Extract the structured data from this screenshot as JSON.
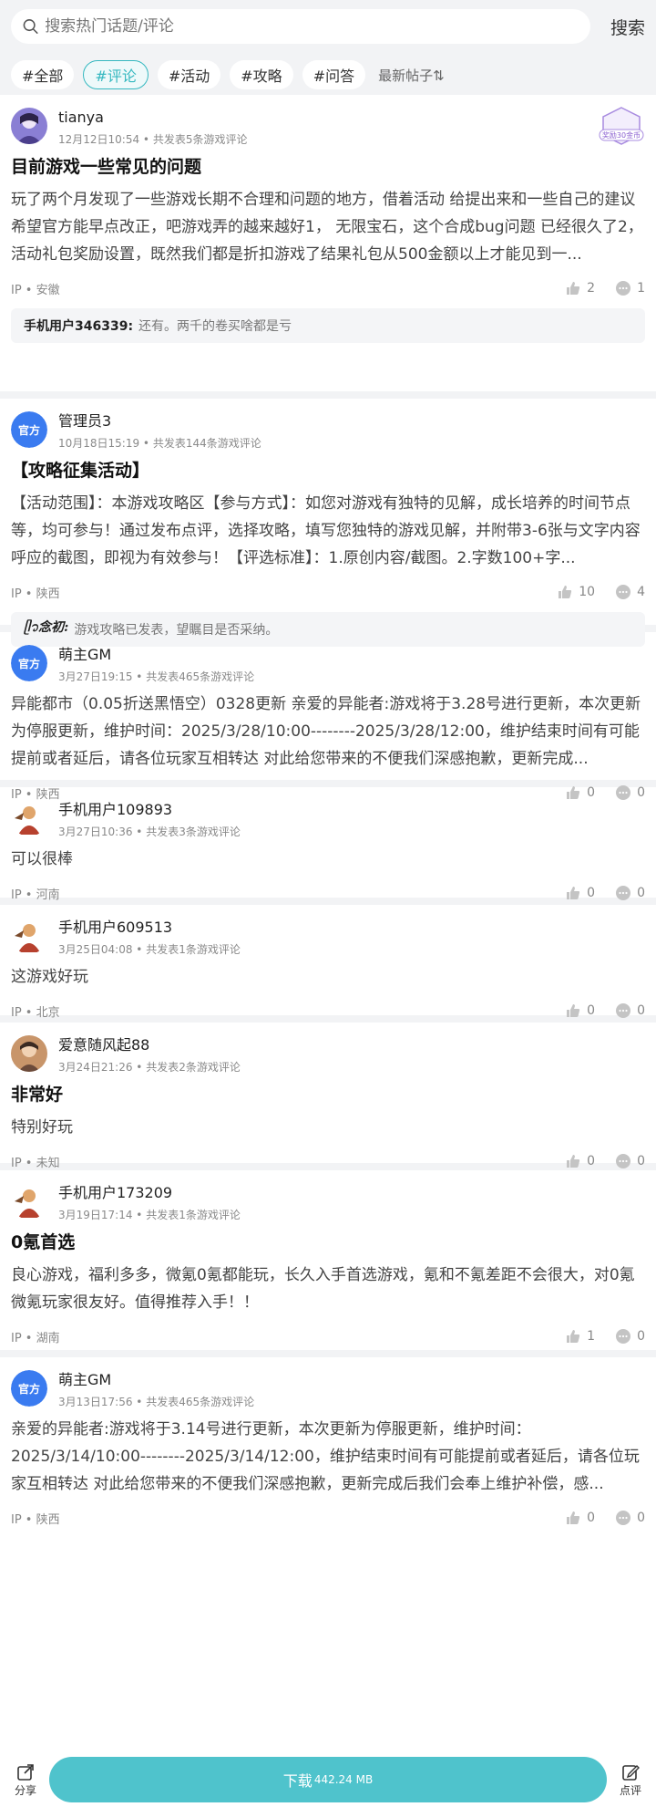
{
  "search": {
    "placeholder": "搜索热门话题/评论",
    "button": "搜索"
  },
  "filters": {
    "tags": [
      "#全部",
      "#评论",
      "#活动",
      "#攻略",
      "#问答"
    ],
    "active": "#评论",
    "sort": "最新帖子⇅"
  },
  "posts": [
    {
      "user": "tianya",
      "sub": "12月12日10:54 • 共发表5条游戏评论",
      "title": "目前游戏一些常见的问题",
      "content": "玩了两个月发现了一些游戏长期不合理和问题的地方，借着活动 给提出来和一些自己的建议 希望官方能早点改正，吧游戏弄的越来越好1， 无限宝石，这个合成bug问题 已经很久了2，活动礼包奖励设置，既然我们都是折扣游戏了结果礼包从500金额以上才能见到一...",
      "ip": "IP • 安徽",
      "likes": "2",
      "comments": "1",
      "badge": "奖励30金币",
      "reply_user": "手机用户346339:",
      "reply_text": "还有。两千的卷买啥都是亏"
    },
    {
      "user": "管理员3",
      "sub": "10月18日15:19 • 共发表144条游戏评论",
      "title": "【攻略征集活动】",
      "content": "【活动范围】：本游戏攻略区【参与方式】：如您对游戏有独特的见解，成长培养的时间节点等，均可参与！通过发布点评，选择攻略，填写您独特的游戏见解，并附带3-6张与文字内容呼应的截图，即视为有效参与！【评选标准】：1.原创内容/截图。2.字数100+字...",
      "ip": "IP • 陕西",
      "likes": "10",
      "comments": "4",
      "reply_user": "ᥫ᭡念初:",
      "reply_text": "游戏攻略已发表，望瞩目是否采纳。"
    },
    {
      "user": "萌主GM",
      "sub": "3月27日19:15 • 共发表465条游戏评论",
      "content": "异能都市（0.05折送黑悟空）0328更新 亲爱的异能者:游戏将于3.28号进行更新，本次更新为停服更新，维护时间：2025/3/28/10:00--------2025/3/28/12:00，维护结束时间有可能提前或者延后，请各位玩家互相转达 对此给您带来的不便我们深感抱歉，更新完成...",
      "ip": "IP • 陕西",
      "likes": "0",
      "comments": "0"
    },
    {
      "user": "手机用户109893",
      "sub": "3月27日10:36 • 共发表3条游戏评论",
      "content": "可以很棒",
      "ip": "IP • 河南",
      "likes": "0",
      "comments": "0"
    },
    {
      "user": "手机用户609513",
      "sub": "3月25日04:08 • 共发表1条游戏评论",
      "content": "这游戏好玩",
      "ip": "IP • 北京",
      "likes": "0",
      "comments": "0"
    },
    {
      "user": "爱意随风起88",
      "sub": "3月24日21:26 • 共发表2条游戏评论",
      "title": "非常好",
      "content": "特别好玩",
      "ip": "IP • 未知",
      "likes": "0",
      "comments": "0"
    },
    {
      "user": "手机用户173209",
      "sub": "3月19日17:14 • 共发表1条游戏评论",
      "title": "0氪首选",
      "content": "良心游戏，福利多多，微氪0氪都能玩，长久入手首选游戏，氪和不氪差距不会很大，对0氪微氪玩家很友好。值得推荐入手！！",
      "ip": "IP • 湖南",
      "likes": "1",
      "comments": "0"
    },
    {
      "user": "萌主GM",
      "sub": "3月13日17:56 • 共发表465条游戏评论",
      "content": "亲爱的异能者:游戏将于3.14号进行更新，本次更新为停服更新，维护时间：2025/3/14/10:00--------2025/3/14/12:00，维护结束时间有可能提前或者延后，请各位玩家互相转达 对此给您带来的不便我们深感抱歉，更新完成后我们会奉上维护补偿，感...",
      "ip": "IP • 陕西",
      "likes": "0",
      "comments": "0"
    }
  ],
  "official_label": "官方",
  "bottom": {
    "share": "分享",
    "download": "下载",
    "size": "442.24 MB",
    "review": "点评"
  },
  "colors": {
    "accent": "#4fc3cc",
    "official": "#3a7bf0"
  }
}
